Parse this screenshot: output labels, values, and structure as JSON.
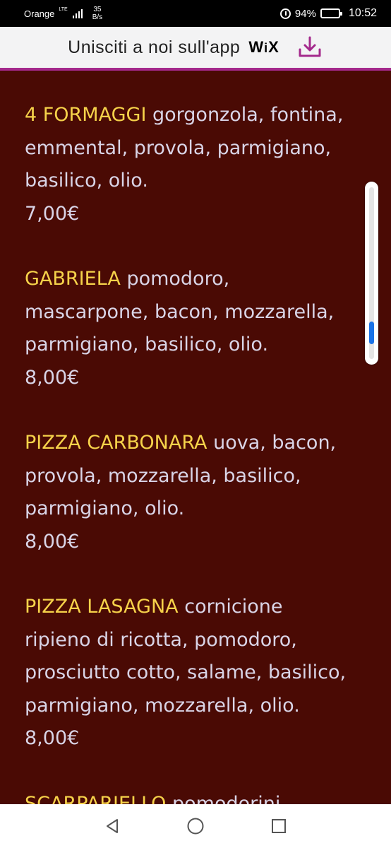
{
  "status_bar": {
    "carrier": "Orange",
    "network": "LTE",
    "net_speed_value": "35",
    "net_speed_unit": "B/s",
    "battery": "94%",
    "battery_level": 0.94,
    "time": "10:52"
  },
  "banner": {
    "text": "Unisciti a noi sull'app",
    "brand": "WiX",
    "accent_color": "#a4298c",
    "icon": "download-icon"
  },
  "menu": {
    "items": [
      {
        "name": "4 FORMAGGI",
        "ingredients": "gorgonzola, fontina, emmental, provola, parmigiano, basilico, olio.",
        "price": "7,00€"
      },
      {
        "name": "GABRIELA",
        "ingredients": "pomodoro, mascarpone, bacon, mozzarella, parmigiano, basilico, olio.",
        "price": "8,00€"
      },
      {
        "name": "PIZZA CARBONARA",
        "ingredients": "uova, bacon, provola, mozzarella, basilico, parmigiano, olio.",
        "price": "8,00€"
      },
      {
        "name": "PIZZA LASAGNA",
        "ingredients": "cornicione ripieno di ricotta, pomodoro, prosciutto cotto, salame, basilico, parmigiano, mozzarella, olio.",
        "price": "8,00€"
      },
      {
        "name": "SCARPARIELLO",
        "ingredients": "pomodorini",
        "price": ""
      }
    ]
  },
  "scroll": {
    "position": 0.9
  },
  "nav_bar": {
    "back": "back-triangle-icon",
    "home": "home-circle-icon",
    "recents": "recents-square-icon"
  }
}
